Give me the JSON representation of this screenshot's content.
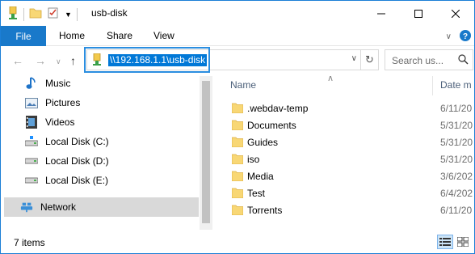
{
  "window": {
    "title": "usb-disk",
    "accent": "#1979ca"
  },
  "title_bar": {
    "qat_icons": [
      "usb-drive-icon",
      "folder-icon",
      "properties-icon",
      "dropdown-icon"
    ],
    "caption_buttons": [
      "minimize-icon",
      "maximize-icon",
      "close-icon"
    ]
  },
  "ribbon": {
    "file_label": "File",
    "tabs": [
      "Home",
      "Share",
      "View"
    ]
  },
  "address": {
    "path": "\\\\192.168.1.1\\usb-disk",
    "search_placeholder": "Search us..."
  },
  "nav": {
    "items": [
      {
        "label": "Music",
        "icon": "music-icon"
      },
      {
        "label": "Pictures",
        "icon": "pictures-icon"
      },
      {
        "label": "Videos",
        "icon": "videos-icon"
      },
      {
        "label": "Local Disk (C:)",
        "icon": "drive-c-icon"
      },
      {
        "label": "Local Disk (D:)",
        "icon": "drive-icon"
      },
      {
        "label": "Local Disk (E:)",
        "icon": "drive-icon"
      },
      {
        "label": "Network",
        "icon": "network-icon",
        "selected": true
      }
    ]
  },
  "columns": {
    "name": "Name",
    "date": "Date m"
  },
  "files": [
    {
      "name": ".webdav-temp",
      "date": "6/11/20"
    },
    {
      "name": "Documents",
      "date": "5/31/20"
    },
    {
      "name": "Guides",
      "date": "5/31/20"
    },
    {
      "name": "iso",
      "date": "5/31/20"
    },
    {
      "name": "Media",
      "date": "3/6/202"
    },
    {
      "name": "Test",
      "date": "6/4/202"
    },
    {
      "name": "Torrents",
      "date": "6/11/20"
    }
  ],
  "status": {
    "item_count": "7 items"
  }
}
